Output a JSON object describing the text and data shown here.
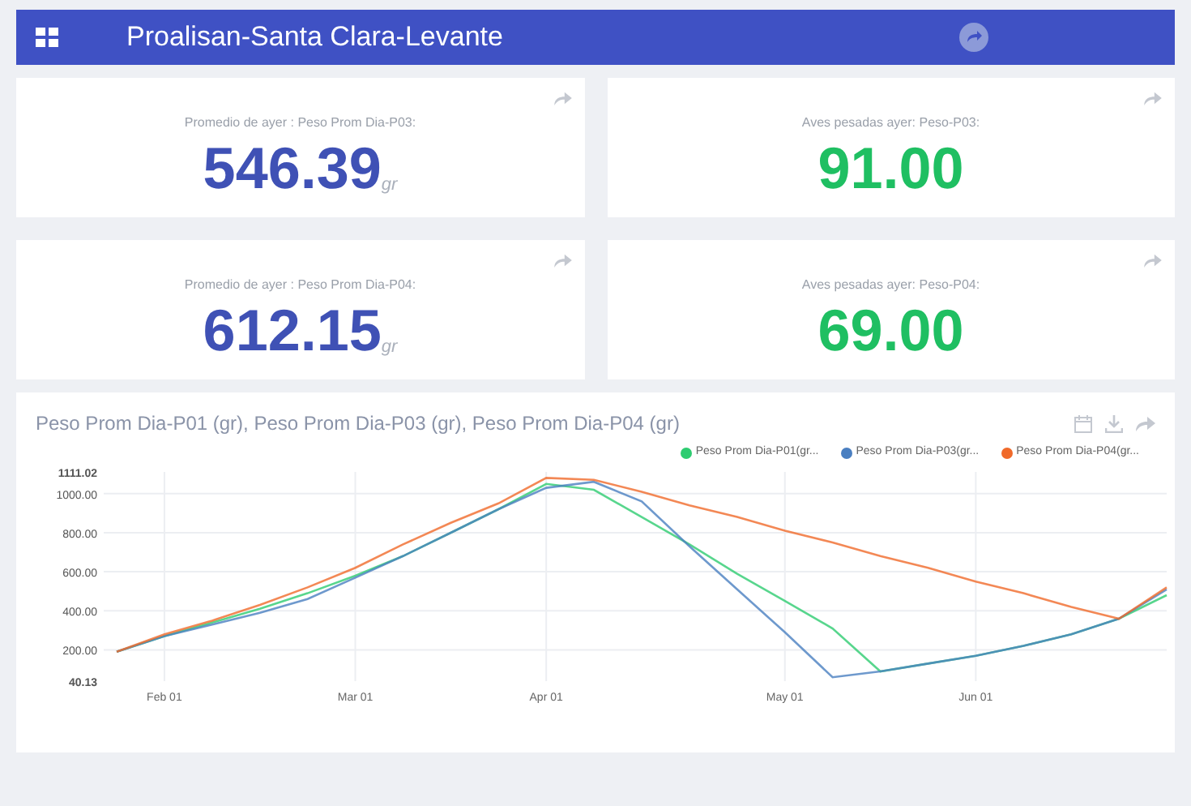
{
  "header": {
    "title": "Proalisan-Santa Clara-Levante"
  },
  "cards": [
    {
      "label": "Promedio de ayer : Peso Prom Dia-P03:",
      "value": "546.39",
      "unit": "gr",
      "color": "#3f51b5"
    },
    {
      "label": "Aves pesadas ayer: Peso-P03:",
      "value": "91.00",
      "color": "#1fbf62"
    },
    {
      "label": "Promedio de ayer : Peso Prom Dia-P04:",
      "value": "612.15",
      "unit": "gr",
      "color": "#3f51b5"
    },
    {
      "label": "Aves pesadas ayer: Peso-P04:",
      "value": "69.00",
      "color": "#1fbf62"
    }
  ],
  "chart": {
    "chart_data": {
      "type": "line",
      "title": "Peso Prom Dia-P01 (gr), Peso Prom Dia-P03 (gr), Peso Prom Dia-P04 (gr)",
      "categories": [
        null,
        "Feb 01",
        null,
        null,
        null,
        "Mar 01",
        null,
        null,
        null,
        "Apr 01",
        null,
        null,
        null,
        null,
        "May 01",
        null,
        null,
        null,
        "Jun 01",
        null,
        null,
        null,
        null
      ],
      "series": [
        {
          "name": "Peso Prom Dia-P01(gr...",
          "color": "#2ecc71",
          "values": [
            190,
            270,
            340,
            410,
            490,
            580,
            680,
            800,
            920,
            1050,
            1020,
            880,
            740,
            590,
            450,
            310,
            90,
            130,
            170,
            220,
            280,
            360,
            480
          ]
        },
        {
          "name": "Peso Prom Dia-P03(gr...",
          "color": "#4a7fc1",
          "values": [
            190,
            270,
            330,
            390,
            460,
            570,
            680,
            800,
            920,
            1030,
            1060,
            960,
            730,
            510,
            290,
            60,
            90,
            130,
            170,
            220,
            280,
            360,
            510
          ]
        },
        {
          "name": "Peso Prom Dia-P04(gr...",
          "color": "#f06a2a",
          "values": [
            190,
            280,
            350,
            430,
            520,
            620,
            740,
            850,
            950,
            1080,
            1070,
            1010,
            940,
            880,
            810,
            750,
            680,
            620,
            550,
            490,
            420,
            360,
            520
          ]
        }
      ],
      "grid": true,
      "ylim": [
        40.13,
        1111.02
      ],
      "yticks": [
        {
          "value": 40.13,
          "label": "40.13"
        },
        {
          "value": 200,
          "label": "200.00"
        },
        {
          "value": 400,
          "label": "400.00"
        },
        {
          "value": 600,
          "label": "600.00"
        },
        {
          "value": 800,
          "label": "800.00"
        },
        {
          "value": 1000,
          "label": "1000.00"
        },
        {
          "value": 1111.02,
          "label": "1111.02"
        }
      ]
    }
  }
}
